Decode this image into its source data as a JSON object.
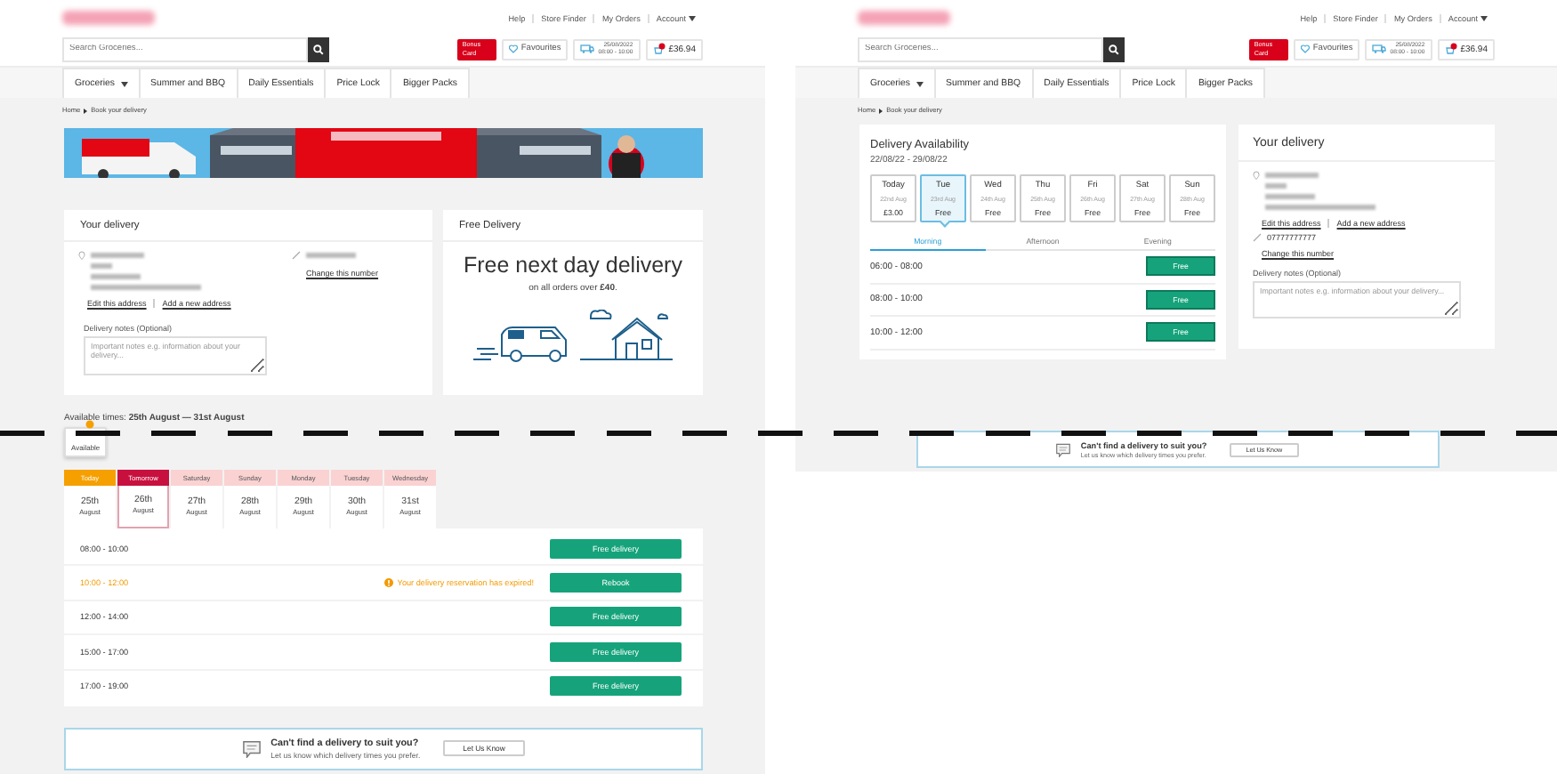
{
  "screens": [
    {
      "kind": "day_tabs",
      "header": {
        "links": [
          {
            "label": "Help",
            "dropdown": false
          },
          {
            "label": "Store Finder",
            "dropdown": false
          },
          {
            "label": "My Orders",
            "dropdown": false
          },
          {
            "label": "Account",
            "dropdown": true
          }
        ],
        "search_placeholder": "Search Groceries...",
        "bonus_card": [
          "Bonus",
          "Card"
        ],
        "favourites": "Favourites",
        "slot_date": "25/08/2022",
        "slot_time": "08:00 - 10:00",
        "basket_total": "£36.94"
      },
      "nav": [
        {
          "label": "Groceries",
          "dropdown": true
        },
        {
          "label": "Summer and BBQ",
          "dropdown": false
        },
        {
          "label": "Daily Essentials",
          "dropdown": false
        },
        {
          "label": "Price Lock",
          "dropdown": false
        },
        {
          "label": "Bigger Packs",
          "dropdown": false
        }
      ],
      "breadcrumb": [
        "Home",
        "Book your delivery"
      ],
      "banner": {
        "kind": "picture"
      },
      "your_delivery": {
        "title": "Your delivery",
        "address_links": [
          "Edit this address",
          "Add a new address"
        ],
        "phone_link": "Change this number",
        "notes_label": "Delivery notes (Optional)",
        "notes_placeholder": "Important notes e.g. information about your delivery..."
      },
      "free_delivery": {
        "title": "Free Delivery",
        "headline": "Free next day delivery",
        "subline": "on all orders over **£40**."
      },
      "available_times": "Available times: **25th August — 31st August**",
      "tooltip": "Available",
      "days": [
        {
          "day": "Today",
          "date": "25th",
          "month": "August",
          "color": "#f5a000",
          "selected": false
        },
        {
          "day": "Tomorrow",
          "date": "26th",
          "month": "August",
          "color": "#c8103e",
          "selected": true
        },
        {
          "day": "Saturday",
          "date": "27th",
          "month": "August",
          "color": "#fad2d2",
          "selected": false
        },
        {
          "day": "Sunday",
          "date": "28th",
          "month": "August",
          "color": "#fad2d2",
          "selected": false
        },
        {
          "day": "Monday",
          "date": "29th",
          "month": "August",
          "color": "#fad2d2",
          "selected": false
        },
        {
          "day": "Tuesday",
          "date": "30th",
          "month": "August",
          "color": "#fad2d2",
          "selected": false
        },
        {
          "day": "Wednesday",
          "date": "31st",
          "month": "August",
          "color": "#fad2d2",
          "selected": false
        }
      ],
      "slots": [
        {
          "time": "08:00 - 10:00",
          "kind": "available",
          "button": "Free delivery"
        },
        {
          "time": "10:00 - 12:00",
          "kind": "expired",
          "message": "Your delivery reservation has expired!",
          "button": "Rebook"
        },
        {
          "time": "12:00 - 14:00",
          "kind": "available",
          "button": "Free delivery"
        },
        {
          "time": "15:00 - 17:00",
          "kind": "available",
          "button": "Free delivery"
        },
        {
          "time": "17:00 - 19:00",
          "kind": "available",
          "button": "Free delivery"
        }
      ],
      "help_box": {
        "title": "Can't find a delivery to suit you?",
        "text": "Let us know which delivery times you prefer.",
        "button": "Let Us Know"
      }
    },
    {
      "kind": "day_cards",
      "header": {
        "links": [
          {
            "label": "Help",
            "dropdown": false
          },
          {
            "label": "Store Finder",
            "dropdown": false
          },
          {
            "label": "My Orders",
            "dropdown": false
          },
          {
            "label": "Account",
            "dropdown": true
          }
        ],
        "search_placeholder": "Search Groceries...",
        "bonus_card": [
          "Bonus",
          "Card"
        ],
        "favourites": "Favourites",
        "slot_date": "25/08/2022",
        "slot_time": "08:00 - 10:00",
        "basket_total": "£36.94"
      },
      "nav": [
        {
          "label": "Groceries",
          "dropdown": true
        },
        {
          "label": "Summer and BBQ",
          "dropdown": false
        },
        {
          "label": "Daily Essentials",
          "dropdown": false
        },
        {
          "label": "Price Lock",
          "dropdown": false
        },
        {
          "label": "Bigger Packs",
          "dropdown": false
        }
      ],
      "breadcrumb": [
        "Home",
        "Book your delivery"
      ],
      "availability": {
        "title": "Delivery Availability",
        "range": "22/08/22 - 29/08/22"
      },
      "days": [
        {
          "day": "Today",
          "date": "22nd Aug",
          "price": "£3.00",
          "selected": false
        },
        {
          "day": "Tue",
          "date": "23rd Aug",
          "price": "Free",
          "selected": true
        },
        {
          "day": "Wed",
          "date": "24th Aug",
          "price": "Free",
          "selected": false
        },
        {
          "day": "Thu",
          "date": "25th Aug",
          "price": "Free",
          "selected": false
        },
        {
          "day": "Fri",
          "date": "26th Aug",
          "price": "Free",
          "selected": false
        },
        {
          "day": "Sat",
          "date": "27th Aug",
          "price": "Free",
          "selected": false
        },
        {
          "day": "Sun",
          "date": "28th Aug",
          "price": "Free",
          "selected": false
        }
      ],
      "periods": [
        {
          "label": "Morning",
          "selected": true
        },
        {
          "label": "Afternoon",
          "selected": false
        },
        {
          "label": "Evening",
          "selected": false
        }
      ],
      "slots": [
        {
          "time": "06:00 - 08:00",
          "button": "Free"
        },
        {
          "time": "08:00 - 10:00",
          "button": "Free"
        },
        {
          "time": "10:00 - 12:00",
          "button": "Free"
        }
      ],
      "your_delivery": {
        "title": "Your delivery",
        "address_links": [
          "Edit this address",
          "Add a new address"
        ],
        "phone": "07777777777",
        "phone_link": "Change this number",
        "notes_label": "Delivery notes (Optional)",
        "notes_placeholder": "Important notes e.g. information about your delivery..."
      },
      "help_box": {
        "title": "Can't find a delivery to suit you?",
        "text": "Let us know which delivery times you prefer.",
        "button": "Let Us Know"
      }
    }
  ]
}
